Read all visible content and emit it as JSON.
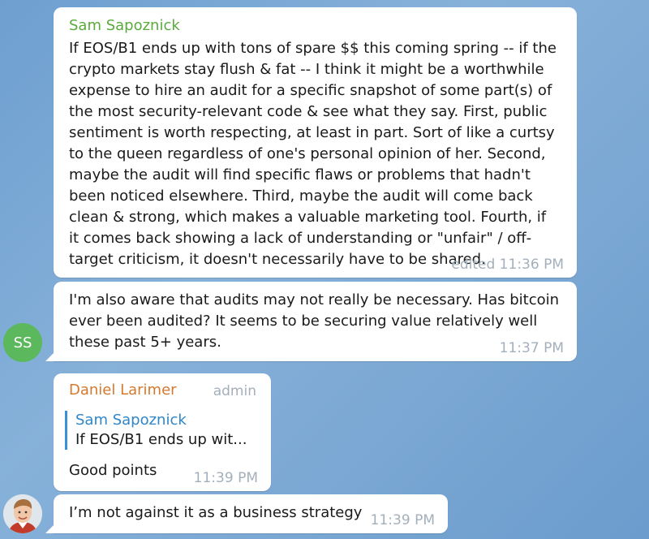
{
  "messages": [
    {
      "sender": "Sam Sapoznick",
      "sender_color": "#5aab3c",
      "text": "If EOS/B1 ends up with tons of spare $$ this coming spring -- if the crypto markets stay flush & fat -- I think it might be a worthwhile expense to hire an audit for a specific snapshot of some part(s) of the  most security-relevant code & see what they say. First, public sentiment is worth respecting, at least in part. Sort of like a curtsy to the queen regardless of one's personal opinion of her. Second, maybe the audit will find specific flaws or problems that hadn't been noticed elsewhere. Third, maybe the audit will come back clean & strong, which makes a valuable marketing tool. Fourth, if it comes back showing a lack of understanding or \"unfair\" / off-target criticism, it doesn't necessarily have to be shared.",
      "time": "edited 11:36 PM"
    },
    {
      "text": "I'm also aware that audits may not really be necessary. Has bitcoin ever been audited? It seems to be securing value relatively well these past 5+ years.",
      "time": "11:37 PM",
      "avatar_initials": "SS",
      "avatar_color": "#5cb85c"
    },
    {
      "sender": "Daniel Larimer",
      "sender_color": "#d37a2f",
      "role": "admin",
      "reply": {
        "name": "Sam Sapoznick",
        "text": "If EOS/B1 ends up wit..."
      },
      "text": "Good points",
      "time": "11:39 PM"
    },
    {
      "text": "I’m not against it as a business strategy",
      "time": "11:39 PM",
      "avatar_icon": "user-photo-icon"
    }
  ]
}
